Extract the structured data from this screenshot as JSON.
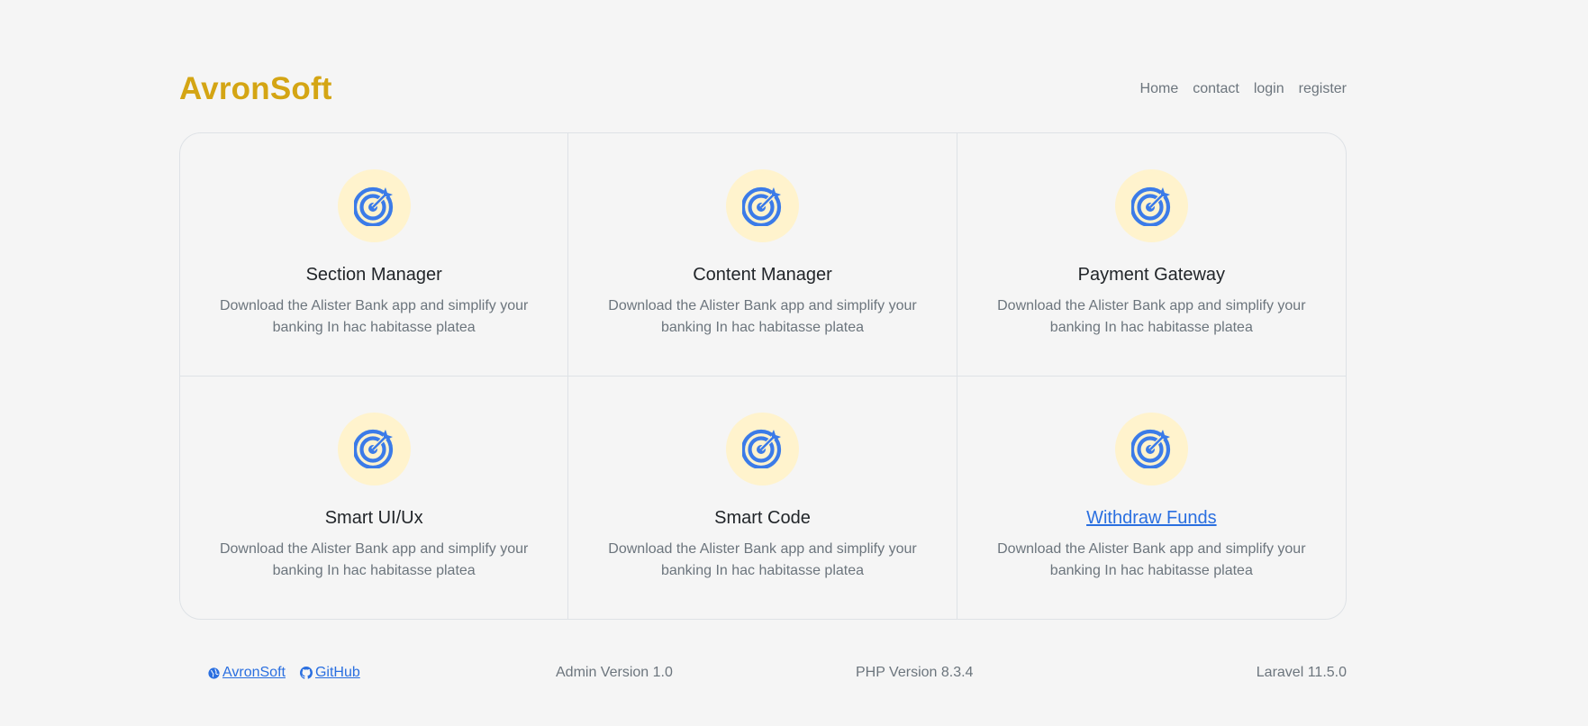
{
  "brand": "AvronSoft",
  "nav": [
    "Home",
    "contact",
    "login",
    "register"
  ],
  "features": [
    {
      "title": "Section Manager",
      "text": "Download the Alister Bank app and simplify your banking In hac habitasse platea",
      "icon": "target-icon"
    },
    {
      "title": "Content Manager",
      "text": "Download the Alister Bank app and simplify your banking In hac habitasse platea",
      "icon": "target-icon"
    },
    {
      "title": "Payment Gateway",
      "text": "Download the Alister Bank app and simplify your banking In hac habitasse platea",
      "icon": "target-icon"
    },
    {
      "title": "Smart UI/Ux",
      "text": "Download the Alister Bank app and simplify your banking In hac habitasse platea",
      "icon": "target-icon"
    },
    {
      "title": "Smart Code",
      "text": "Download the Alister Bank app and simplify your banking In hac habitasse platea",
      "icon": "target-icon"
    },
    {
      "title": "Withdraw Funds",
      "text": "Download the Alister Bank app and simplify your banking In hac habitasse platea",
      "icon": "target-icon",
      "link": true
    }
  ],
  "footer": {
    "site_link": "AvronSoft",
    "github_link": "GitHub",
    "admin_version": "Admin Version 1.0",
    "php_version": "PHP Version 8.3.4",
    "laravel_version": "Laravel 11.5.0"
  },
  "colors": {
    "brand": "#d4a514",
    "accent": "#2a6fe0",
    "icon_bg": "#fff3cd",
    "icon_fg": "#3b7be8"
  }
}
